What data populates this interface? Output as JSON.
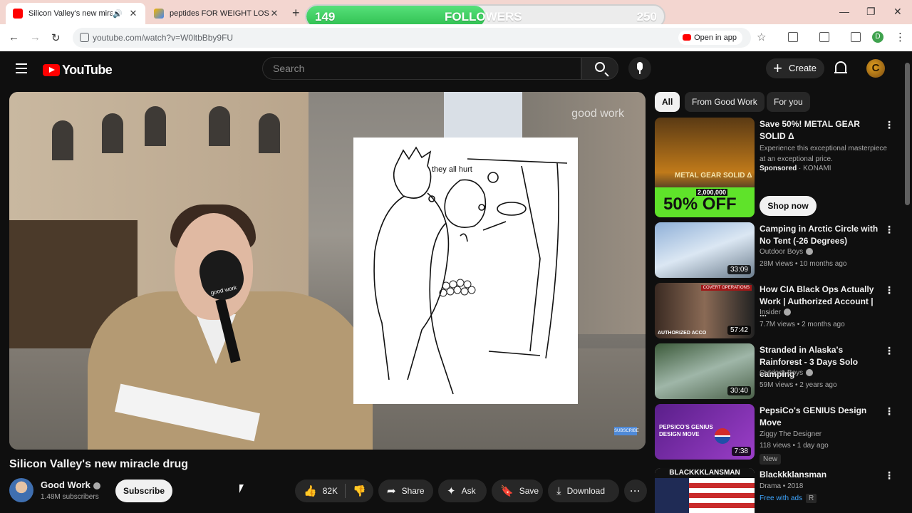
{
  "browser": {
    "tabs": [
      {
        "title": "Silicon Valley's new miracle",
        "active": true
      },
      {
        "title": "peptides FOR WEIGHT LOSS - G",
        "active": false
      }
    ],
    "url": "youtube.com/watch?v=W0ltbBby9FU",
    "open_in_app": "Open in app",
    "profile_letter": "D"
  },
  "followers_overlay": {
    "current": "149",
    "label": "FOLLOWERS",
    "goal": "250",
    "progress_fraction": 0.5,
    "fill_color": "#2fbf4f"
  },
  "youtube": {
    "logo_text": "YouTube",
    "search_placeholder": "Search",
    "create_label": "Create",
    "avatar_letter": "C"
  },
  "video": {
    "watermark": "good work",
    "mic_label": "good work",
    "meme_caption": "they all hurt",
    "subscribe_watermark": "SUBSCRIBE",
    "title": "Silicon Valley's new miracle drug",
    "channel": "Good Work",
    "subscribers": "1.48M subscribers",
    "subscribe_label": "Subscribe",
    "likes": "82K",
    "share_label": "Share",
    "ask_label": "Ask",
    "save_label": "Save",
    "download_label": "Download"
  },
  "chips": [
    "All",
    "From Good Work",
    "For you"
  ],
  "ad": {
    "title": "Save 50%! METAL GEAR SOLID Δ",
    "description": "Experience this exceptional masterpiece at an exceptional price.",
    "sponsored": "Sponsored",
    "advertiser": "KONAMI",
    "cta": "Shop now",
    "thumb_game": "METAL GEAR SOLID Δ",
    "thumb_copies": "2,000,000",
    "thumb_discount": "50% OFF"
  },
  "recommendations": [
    {
      "title": "Camping in Arctic Circle with No Tent (-26 Degrees)",
      "channel": "Outdoor Boys",
      "meta": "28M views • 10 months ago",
      "duration": "33:09",
      "verified": true
    },
    {
      "title": "How CIA Black Ops Actually Work | Authorized Account | ...",
      "channel": "Insider",
      "meta": "7.7M views • 2 months ago",
      "duration": "57:42",
      "verified": true
    },
    {
      "title": "Stranded in Alaska's Rainforest - 3 Days Solo camping",
      "channel": "Outdoor Boys",
      "meta": "59M views • 2 years ago",
      "duration": "30:40",
      "verified": true
    },
    {
      "title": "PepsiCo's GENIUS Design Move",
      "channel": "Ziggy The Designer",
      "meta": "118 views • 1 day ago",
      "duration": "7:38",
      "badge": "New",
      "verified": false
    },
    {
      "title": "Blackkklansman",
      "channel": "Drama • 2018",
      "free": "Free with ads",
      "rating": "R",
      "thumb_text": "BLACKKKLANSMAN"
    }
  ],
  "thumb_texts": {
    "cia_banner": "COVERT OPERATIONS",
    "cia_footer": "AUTHORIZED ACCO",
    "pepsi_line": "PEPSICO'S GENIUS DESIGN MOVE"
  }
}
